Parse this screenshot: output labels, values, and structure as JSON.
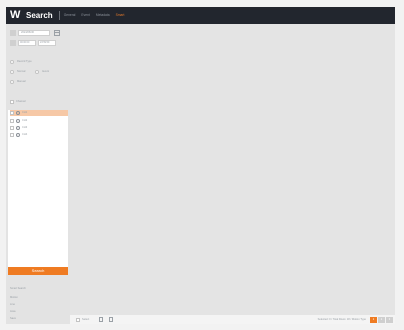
{
  "header": {
    "logo": "W",
    "title": "Search",
    "tabs": [
      {
        "label": "General",
        "active": false
      },
      {
        "label": "Event",
        "active": false
      },
      {
        "label": "Metadata",
        "active": false
      },
      {
        "label": "Smart",
        "active": true
      }
    ]
  },
  "sidebar": {
    "date_value": "2024/06/30",
    "start_time": "00:00:00",
    "end_time": "23:59:59",
    "record_type_label": "Record Type",
    "record_options": [
      {
        "label": "Normal",
        "selected": true
      },
      {
        "label": "Event",
        "selected": false
      }
    ],
    "manual_label": "Manual",
    "channel_label": "Channel",
    "channels": [
      {
        "label": "CH1",
        "selected": true
      },
      {
        "label": "CH2",
        "selected": false
      },
      {
        "label": "CH3",
        "selected": false
      },
      {
        "label": "CH4",
        "selected": false
      }
    ],
    "search_button": "Search",
    "bottom_links": [
      "Smart Search",
      "Motion",
      "Line",
      "Area",
      "Save"
    ]
  },
  "footer": {
    "select_all_label": "Select",
    "stats": "Selected: 0 / Total Rows: 18 / Motion Type",
    "pages": [
      {
        "label": "1",
        "active": true
      },
      {
        "label": "2",
        "active": false
      },
      {
        "label": "3",
        "active": false
      }
    ]
  },
  "colors": {
    "accent": "#ef7b22",
    "topbar": "#22262e",
    "selected_row": "#f6c8a6"
  }
}
